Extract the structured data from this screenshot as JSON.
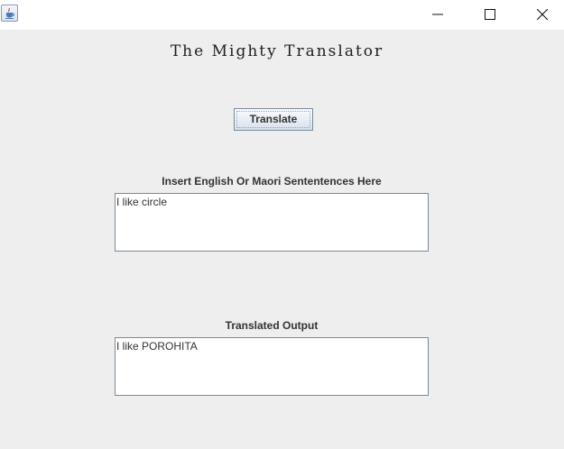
{
  "window": {
    "icon": "java-cup-icon",
    "controls": [
      "minimize-icon",
      "maximize-icon",
      "close-icon"
    ]
  },
  "app": {
    "title": "The Mighty Translator",
    "translate_button": "Translate",
    "input_label": "Insert English Or Maori Sententences Here",
    "input_text": "I like circle",
    "output_label": "Translated Output",
    "output_text": "I like POROHITA"
  },
  "colors": {
    "background": "#eeeeee",
    "titlebar": "#ffffff",
    "button_border": "#7a8a99",
    "text": "#333333"
  }
}
